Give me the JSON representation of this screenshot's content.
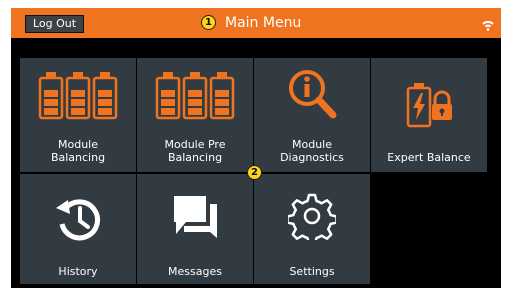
{
  "header": {
    "logout_label": "Log Out",
    "title": "Main Menu",
    "callout_1": "1",
    "accent_color": "#f0731f",
    "status_icon": "wifi-signal-icon"
  },
  "callout_2": "2",
  "tiles": [
    {
      "label": "Module\nBalancing",
      "icon": "battery-array-icon"
    },
    {
      "label": "Module Pre\nBalancing",
      "icon": "battery-array-icon"
    },
    {
      "label": "Module\nDiagnostics",
      "icon": "info-magnifier-icon"
    },
    {
      "label": "Expert Balance",
      "icon": "locked-battery-icon"
    },
    {
      "label": "History",
      "icon": "history-clock-icon"
    },
    {
      "label": "Messages",
      "icon": "chat-bubbles-icon"
    },
    {
      "label": "Settings",
      "icon": "gear-icon"
    }
  ],
  "colors": {
    "tile_bg": "#333b42",
    "icon_orange": "#f0731f",
    "background": "#000000"
  }
}
